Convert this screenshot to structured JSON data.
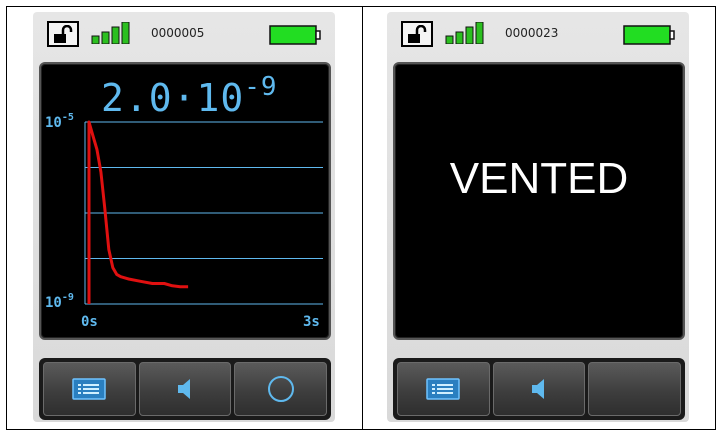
{
  "panels": [
    {
      "status": {
        "serial": "0000005",
        "lock_icon": "unlocked-padlock-icon",
        "signal_icon": "signal-strength-icon",
        "battery_icon": "battery-full-icon"
      },
      "display": {
        "value_mantissa": "2.0·10",
        "value_exponent": "-9",
        "y_top_base": "10",
        "y_top_exp": "-5",
        "y_bottom_base": "10",
        "y_bottom_exp": "-9",
        "x_start": "0s",
        "x_end": "3s"
      },
      "buttons": [
        {
          "icon": "list-icon"
        },
        {
          "icon": "speaker-icon"
        },
        {
          "icon": "circle-icon"
        }
      ]
    },
    {
      "status": {
        "serial": "0000023",
        "lock_icon": "unlocked-padlock-icon",
        "signal_icon": "signal-strength-icon",
        "battery_icon": "battery-full-icon"
      },
      "display": {
        "message": "VENTED"
      },
      "buttons": [
        {
          "icon": "list-icon"
        },
        {
          "icon": "speaker-icon"
        },
        {
          "icon": ""
        }
      ]
    }
  ],
  "colors": {
    "trace": "#e01010",
    "accent": "#5fb9ee",
    "battery": "#22dd22",
    "signal": "#2bbf1f"
  },
  "chart_data": {
    "type": "line",
    "xlabel": "",
    "ylabel": "",
    "x_tick_labels": [
      "0s",
      "3s"
    ],
    "y_tick_labels": [
      "10^-5",
      "10^-9"
    ],
    "xlim": [
      0,
      3
    ],
    "ylim_log10": [
      -9,
      -5
    ],
    "y_scale": "log",
    "grid": true,
    "series": [
      {
        "x": [
          0.05,
          0.1,
          0.15,
          0.2,
          0.25,
          0.3,
          0.35,
          0.4,
          0.45,
          0.55,
          0.7,
          0.85,
          1.0,
          1.1,
          1.2,
          1.3
        ],
        "y_log10": [
          -5.0,
          -5.3,
          -5.6,
          -6.1,
          -6.9,
          -7.8,
          -8.2,
          -8.35,
          -8.4,
          -8.45,
          -8.5,
          -8.55,
          -8.55,
          -8.6,
          -8.62,
          -8.62
        ]
      }
    ]
  }
}
